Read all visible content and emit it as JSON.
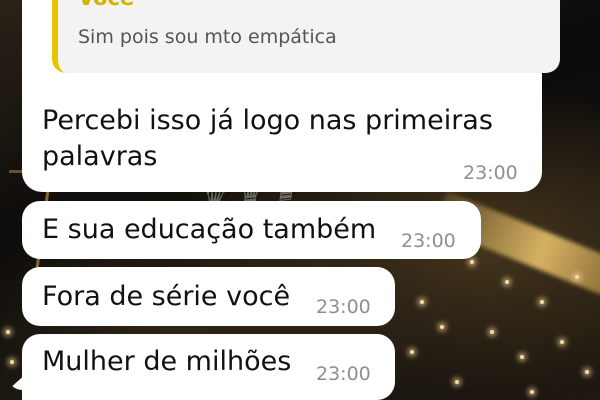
{
  "chat": {
    "quoted": {
      "author": "Você",
      "text": "Sim pois sou mto empática"
    },
    "messages": [
      {
        "line1": "Percebi isso já logo nas primeiras",
        "line2": "palavras",
        "time": "23:00"
      },
      {
        "text": "E sua educação também",
        "time": "23:00"
      },
      {
        "text": "Fora de série você",
        "time": "23:00"
      },
      {
        "text": "Mulher de milhões",
        "time": "23:00"
      }
    ]
  },
  "colors": {
    "quote_accent": "#e8c400",
    "bubble": "#ffffff",
    "time_text": "#8e8e93"
  }
}
